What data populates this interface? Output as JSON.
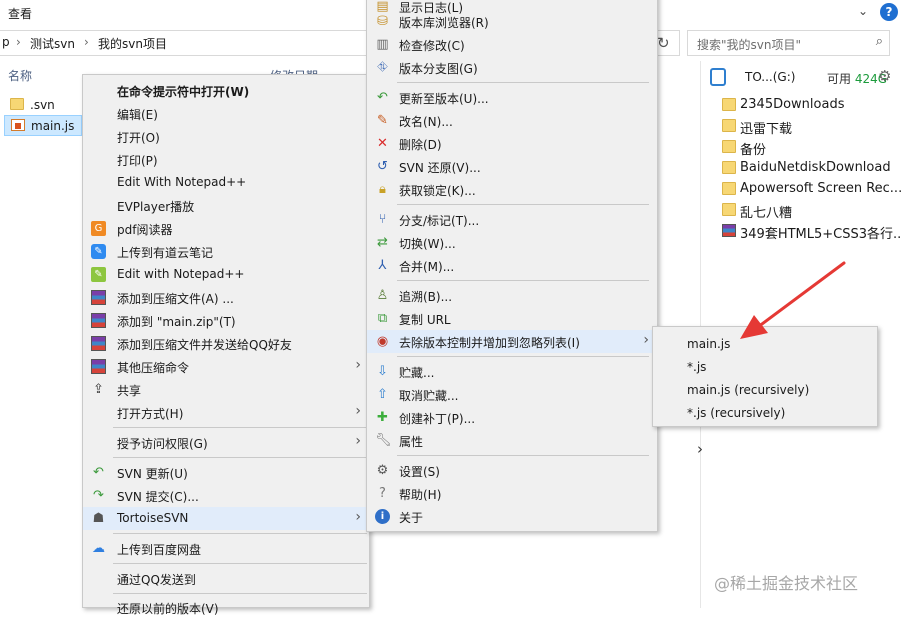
{
  "ribbon": {
    "menu": "查看",
    "collapse": "⌄",
    "help": "?"
  },
  "address": {
    "crumbs": [
      "p",
      "测试svn",
      "我的svn项目"
    ],
    "sep": "›"
  },
  "search": {
    "placeholder": "搜索\"我的svn项目\""
  },
  "columns": {
    "name": "名称",
    "date": "修改日期"
  },
  "files": [
    {
      "name": ".svn",
      "icon": "folder-icon"
    },
    {
      "name": "main.js",
      "icon": "js-file-icon"
    }
  ],
  "drive": {
    "name": "TO...(G:)",
    "free_label": "可用",
    "free_value": "424G"
  },
  "side_items": [
    {
      "name": "2345Downloads",
      "icon": "folder-icon"
    },
    {
      "name": "迅雷下载",
      "icon": "folder-icon"
    },
    {
      "name": "备份",
      "icon": "folder-icon"
    },
    {
      "name": "BaiduNetdiskDownload",
      "icon": "folder-icon"
    },
    {
      "name": "Apowersoft Screen Rec...",
      "icon": "folder-icon"
    },
    {
      "name": "乱七八糟",
      "icon": "folder-icon"
    },
    {
      "name": "349套HTML5+CSS3各行...",
      "icon": "rar-icon"
    }
  ],
  "context_menu": {
    "items": [
      {
        "label": "在命令提示符中打开(W)",
        "bold": true
      },
      {
        "label": "编辑(E)"
      },
      {
        "label": "打开(O)"
      },
      {
        "label": "打印(P)"
      },
      {
        "label": "Edit With Notepad++"
      },
      {
        "label": "EVPlayer播放"
      },
      {
        "label": "pdf阅读器"
      },
      {
        "label": "上传到有道云笔记"
      },
      {
        "label": "Edit with Notepad++"
      },
      {
        "label": "添加到压缩文件(A) ..."
      },
      {
        "label": "添加到 \"main.zip\"(T)"
      },
      {
        "label": "添加到压缩文件并发送给QQ好友"
      },
      {
        "label": "其他压缩命令"
      },
      {
        "label": "共享"
      },
      {
        "label": "打开方式(H)"
      },
      {
        "label": "授予访问权限(G)"
      },
      {
        "label": "SVN 更新(U)"
      },
      {
        "label": "SVN 提交(C)..."
      },
      {
        "label": "TortoiseSVN"
      },
      {
        "label": "上传到百度网盘"
      },
      {
        "label": "通过QQ发送到"
      },
      {
        "label": "还原以前的版本(V)"
      }
    ]
  },
  "svn_menu": {
    "items": [
      {
        "label": "显示日志(L)"
      },
      {
        "label": "版本库浏览器(R)"
      },
      {
        "label": "检查修改(C)"
      },
      {
        "label": "版本分支图(G)"
      },
      {
        "label": "更新至版本(U)..."
      },
      {
        "label": "改名(N)..."
      },
      {
        "label": "删除(D)"
      },
      {
        "label": "SVN 还原(V)..."
      },
      {
        "label": "获取锁定(K)..."
      },
      {
        "label": "分支/标记(T)..."
      },
      {
        "label": "切换(W)..."
      },
      {
        "label": "合并(M)..."
      },
      {
        "label": "追溯(B)..."
      },
      {
        "label": "复制 URL"
      },
      {
        "label": "去除版本控制并增加到忽略列表(I)"
      },
      {
        "label": "贮藏..."
      },
      {
        "label": "取消贮藏..."
      },
      {
        "label": "创建补丁(P)..."
      },
      {
        "label": "属性"
      },
      {
        "label": "设置(S)"
      },
      {
        "label": "帮助(H)"
      },
      {
        "label": "关于"
      }
    ]
  },
  "ignore_menu": {
    "items": [
      "main.js",
      "*.js",
      "main.js (recursively)",
      "*.js (recursively)"
    ]
  },
  "arrow_color": "#e53935",
  "watermark": "@稀土掘金技术社区"
}
